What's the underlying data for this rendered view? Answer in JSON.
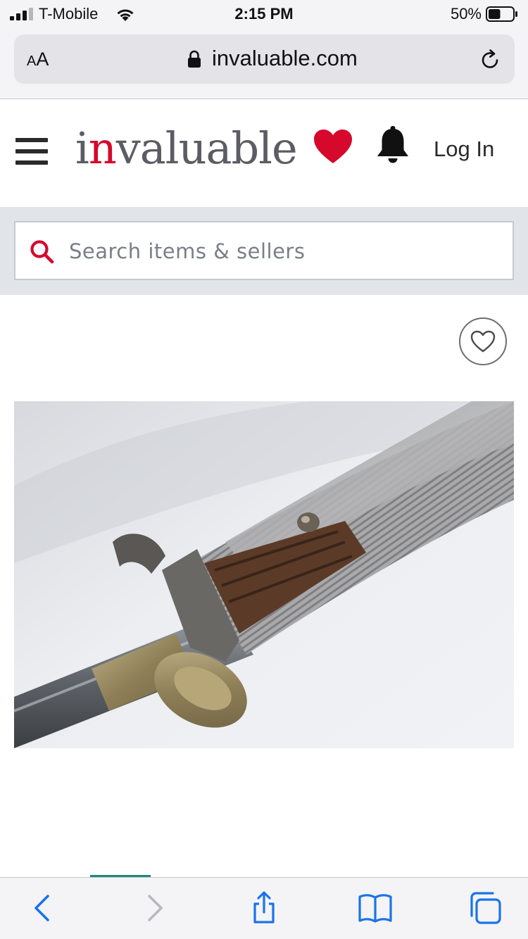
{
  "status_bar": {
    "carrier": "T-Mobile",
    "time": "2:15 PM",
    "battery_percent": "50%",
    "battery_level": 0.5,
    "signal_bars": 3
  },
  "browser": {
    "text_size_label": "AA",
    "url": "invaluable.com"
  },
  "site": {
    "logo_prefix": "i",
    "logo_accent": "n",
    "logo_rest": "valuable",
    "login_label": "Log In",
    "brand_red": "#d6082c"
  },
  "search": {
    "placeholder": "Search items & sellers",
    "value": ""
  },
  "lot": {
    "image_icon": "sword-hilt-photo"
  },
  "icons": {
    "menu": "hamburger-icon",
    "favorites": "heart-icon",
    "notifications": "bell-icon",
    "search": "search-icon",
    "watch": "heart-outline-icon",
    "back": "chevron-left-icon",
    "forward": "chevron-right-icon",
    "share": "share-icon",
    "bookmarks": "book-icon",
    "tabs": "tabs-icon"
  }
}
